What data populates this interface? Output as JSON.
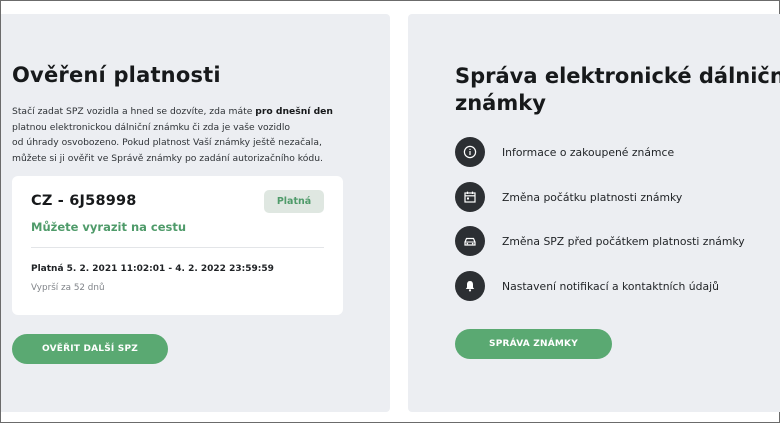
{
  "verification": {
    "title": "Ověření platnosti",
    "desc_part1": "Stačí zadat SPZ vozidla a hned se dozvíte, zda máte ",
    "desc_bold": "pro dnešní den",
    "desc_part2": "platnou elektronickou dálniční známku či zda je vaše vozidlo",
    "desc_part3": "od úhrady osvobozeno. Pokud platnost Vaší známky ještě nezačala,",
    "desc_part4": "můžete si ji ověřit ve Správě známky po zadání autorizačního kódu.",
    "result": {
      "plate": "CZ - 6J58998",
      "badge": "Platná",
      "status_message": "Můžete vyrazit na cestu",
      "validity": "Platná 5. 2. 2021 11:02:01 - 4. 2. 2022 23:59:59",
      "expires": "Vyprší za 52 dnů"
    },
    "button_label": "OVĚŘIT DALŠÍ SPZ"
  },
  "management": {
    "title_line1": "Správa elektronické dálniční",
    "title_line2": "známky",
    "features": [
      {
        "icon": "info-icon",
        "label": "Informace o zakoupené známce"
      },
      {
        "icon": "calendar-icon",
        "label": "Změna počátku platnosti známky"
      },
      {
        "icon": "car-icon",
        "label": "Změna SPZ před počátkem platnosti známky"
      },
      {
        "icon": "bell-icon",
        "label": "Nastavení notifikací a kontaktních údajů"
      }
    ],
    "button_label": "SPRÁVA ZNÁMKY"
  },
  "colors": {
    "accent_green": "#5aa972",
    "status_green": "#4f9b6a",
    "card_background": "#eceef2",
    "icon_background": "#2c2f33"
  }
}
